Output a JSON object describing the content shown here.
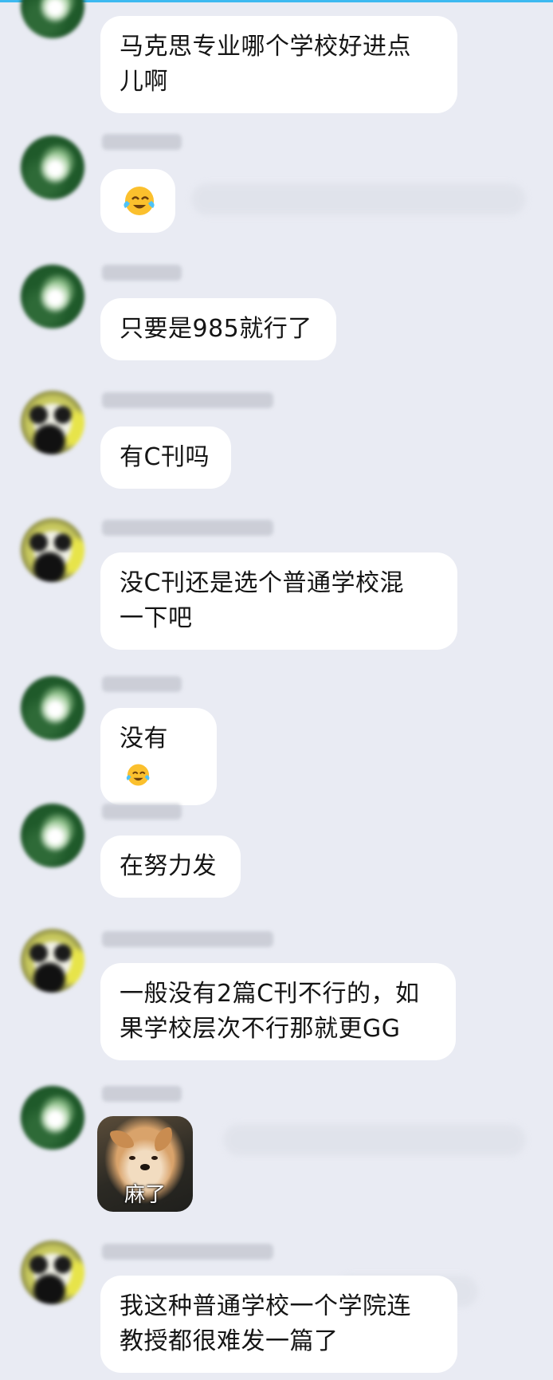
{
  "messages": [
    {
      "sender": "green",
      "text": "马克思专业哪个学校好进点\n儿啊"
    },
    {
      "sender": "green",
      "emoji": "crying-laughing-emoji"
    },
    {
      "sender": "green",
      "text": "只要是985就行了"
    },
    {
      "sender": "panda",
      "text": "有C刊吗"
    },
    {
      "sender": "panda",
      "text": "没C刊还是选个普通学校混\n一下吧"
    },
    {
      "sender": "green",
      "text": "没有",
      "emoji": "crying-laughing-emoji"
    },
    {
      "sender": "green",
      "text": "在努力发"
    },
    {
      "sender": "panda",
      "text": "一般没有2篇C刊不行的，如\n果学校层次不行那就更GG"
    },
    {
      "sender": "green",
      "sticker_caption": "麻了"
    },
    {
      "sender": "panda",
      "text": "我这种普通学校一个学院连\n教授都很难发一篇了"
    }
  ],
  "colors": {
    "background": "#e9ebf3",
    "bubble": "#ffffff",
    "text": "#151515",
    "top_accent": "#3db9f0"
  }
}
